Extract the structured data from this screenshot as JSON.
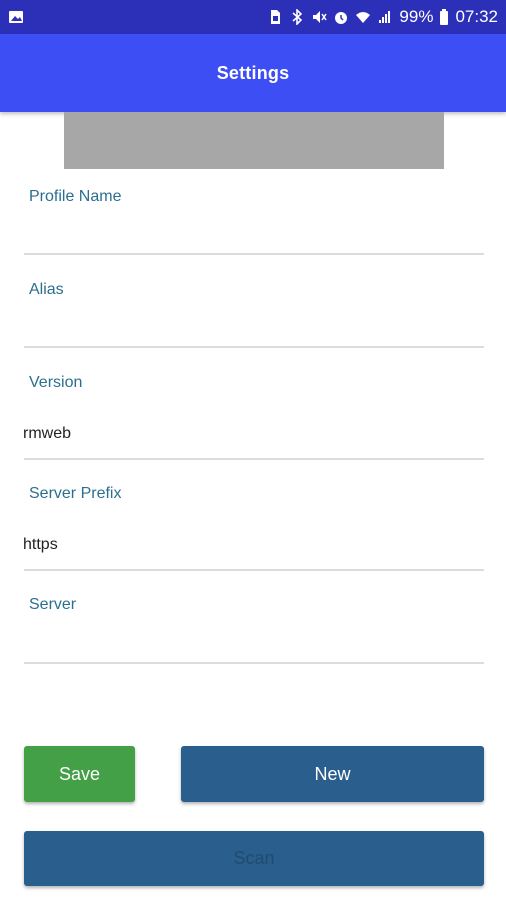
{
  "status_bar": {
    "battery": "99%",
    "time": "07:32",
    "icons": [
      "image-icon",
      "sim-icon",
      "bluetooth-icon",
      "mute-icon",
      "alarm-icon",
      "wifi-icon",
      "signal-icon",
      "battery-icon"
    ]
  },
  "app_bar": {
    "title": "Settings"
  },
  "fields": [
    {
      "label": "Profile Name",
      "value": ""
    },
    {
      "label": "Alias",
      "value": ""
    },
    {
      "label": "Version",
      "value": "rmweb"
    },
    {
      "label": "Server Prefix",
      "value": "https"
    },
    {
      "label": "Server",
      "value": ""
    }
  ],
  "buttons": {
    "save": "Save",
    "new": "New",
    "scan": "Scan"
  },
  "colors": {
    "status_bar": "#2c2fb8",
    "app_bar": "#3d4ff4",
    "label": "#2b6f8f",
    "save": "#43a047",
    "primary": "#2a5f8d"
  }
}
